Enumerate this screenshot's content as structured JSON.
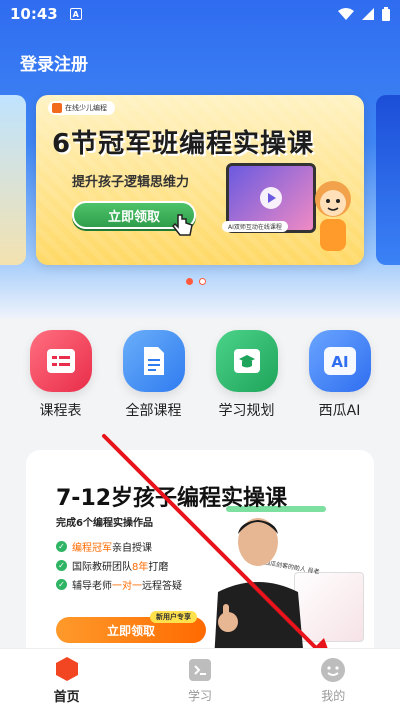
{
  "status_bar": {
    "time": "10:43",
    "notification_letter": "A"
  },
  "header": {
    "title": "登录注册"
  },
  "banner": {
    "brand": "在线少儿编程",
    "title": "6节冠军班编程实操课",
    "subtitle": "提升孩子逻辑思维力",
    "cta": "立即领取",
    "screen_label": "AI双师互动在线课程",
    "active_slide": 1,
    "slide_count": 2
  },
  "quick_nav": [
    {
      "label": "课程表",
      "icon": "schedule-icon",
      "color": "#f2445c"
    },
    {
      "label": "全部课程",
      "icon": "document-icon",
      "color": "#3f8ef5"
    },
    {
      "label": "学习规划",
      "icon": "graduation-cap-icon",
      "color": "#2bb56a"
    },
    {
      "label": "西瓜AI",
      "icon": "ai-icon",
      "color": "#3d7ff4"
    }
  ],
  "promo": {
    "title": "7-12岁孩子编程实操课",
    "subtitle": "完成6个编程实操作品",
    "items": [
      {
        "highlight": "编程冠军",
        "rest": "亲自授课"
      },
      {
        "prefix": "国际教研团队",
        "highlight": "8年",
        "rest": "打磨"
      },
      {
        "prefix": "辅导老师",
        "highlight": "一对一",
        "rest": "远程答疑"
      }
    ],
    "cta": "立即领取",
    "badge": "新用户专享",
    "note": "西瓜创客的助人 肖老"
  },
  "tabbar": [
    {
      "label": "首页",
      "icon": "home-hexagon-icon",
      "active": true
    },
    {
      "label": "学习",
      "icon": "terminal-icon",
      "active": false
    },
    {
      "label": "我的",
      "icon": "profile-face-icon",
      "active": false
    }
  ],
  "colors": {
    "accent": "#ff5a3d",
    "header_blue": "#2f6cf0",
    "arrow_red": "#e8141b"
  }
}
